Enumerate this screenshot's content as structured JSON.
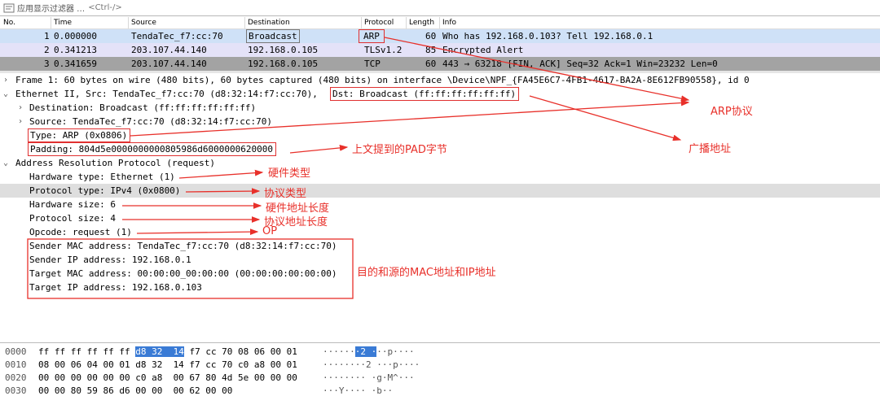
{
  "filter": {
    "label": "应用显示过滤器 …",
    "shortcut": "<Ctrl-/>"
  },
  "columns": {
    "no": "No.",
    "time": "Time",
    "source": "Source",
    "destination": "Destination",
    "protocol": "Protocol",
    "length": "Length",
    "info": "Info"
  },
  "packets": [
    {
      "no": "1",
      "time": "0.000000",
      "source": "TendaTec_f7:cc:70",
      "destination": "Broadcast",
      "protocol": "ARP",
      "length": "60",
      "info": "Who has 192.168.0.103? Tell 192.168.0.1"
    },
    {
      "no": "2",
      "time": "0.341213",
      "source": "203.107.44.140",
      "destination": "192.168.0.105",
      "protocol": "TLSv1.2",
      "length": "85",
      "info": "Encrypted Alert"
    },
    {
      "no": "3",
      "time": "0.341659",
      "source": "203.107.44.140",
      "destination": "192.168.0.105",
      "protocol": "TCP",
      "length": "60",
      "info": "443 → 63218 [FIN, ACK] Seq=32 Ack=1 Win=23232 Len=0"
    }
  ],
  "details": {
    "frame": "Frame 1: 60 bytes on wire (480 bits), 60 bytes captured (480 bits) on interface \\Device\\NPF_{FA45E6C7-4FB1-4617-BA2A-8E612FB90558}, id 0",
    "eth_a": "Ethernet II, Src: TendaTec_f7:cc:70 (d8:32:14:f7:cc:70),",
    "eth_dst": "Dst: Broadcast (ff:ff:ff:ff:ff:ff)",
    "eth_dest": "Destination: Broadcast (ff:ff:ff:ff:ff:ff)",
    "eth_src": "Source: TendaTec_f7:cc:70 (d8:32:14:f7:cc:70)",
    "eth_type": "Type: ARP (0x0806)",
    "eth_pad": "Padding: 804d5e0000000000805986d6000000620000",
    "arp": "Address Resolution Protocol (request)",
    "hw_type": "Hardware type: Ethernet (1)",
    "proto_type": "Protocol type: IPv4 (0x0800)",
    "hw_size": "Hardware size: 6",
    "proto_size": "Protocol size: 4",
    "opcode": "Opcode: request (1)",
    "sender_mac": "Sender MAC address: TendaTec_f7:cc:70 (d8:32:14:f7:cc:70)",
    "sender_ip": "Sender IP address: 192.168.0.1",
    "target_mac": "Target MAC address: 00:00:00_00:00:00 (00:00:00:00:00:00)",
    "target_ip": "Target IP address: 192.168.0.103"
  },
  "hex": [
    {
      "offset": "0000",
      "pre": "ff ff ff ff ff ff ",
      "sel": "d8 32  14",
      "post": " f7 cc 70 08 06 00 01",
      "ascii_pre": "······",
      "ascii_sel": "·2 ·",
      "ascii_post": "··p····"
    },
    {
      "offset": "0010",
      "pre": "08 00 06 04 00 01 d8 32  14 f7 cc 70 c0 a8 00 01",
      "sel": "",
      "post": "",
      "ascii_pre": "········2 ···p····",
      "ascii_sel": "",
      "ascii_post": ""
    },
    {
      "offset": "0020",
      "pre": "00 00 00 00 00 00 c0 a8  00 67 80 4d 5e 00 00 00",
      "sel": "",
      "post": "",
      "ascii_pre": "········ ·g·M^···",
      "ascii_sel": "",
      "ascii_post": ""
    },
    {
      "offset": "0030",
      "pre": "00 00 80 59 86 d6 00 00  00 62 00 00",
      "sel": "",
      "post": "",
      "ascii_pre": "···Y···· ·b··",
      "ascii_sel": "",
      "ascii_post": ""
    }
  ],
  "annotations": {
    "arp_protocol": "ARP协议",
    "broadcast_addr": "广播地址",
    "pad_bytes": "上文提到的PAD字节",
    "hw_type": "硬件类型",
    "proto_type": "协议类型",
    "hw_addr_len": "硬件地址长度",
    "proto_addr_len": "协议地址长度",
    "op": "OP",
    "addr_note": "目的和源的MAC地址和IP地址"
  },
  "colors": {
    "annotation": "#e8302a",
    "row_selected": "#cfe1f7",
    "row_tls": "#e4e2f8",
    "row_tcp": "#a3a3a3",
    "hex_highlight": "#3a7bd5"
  }
}
